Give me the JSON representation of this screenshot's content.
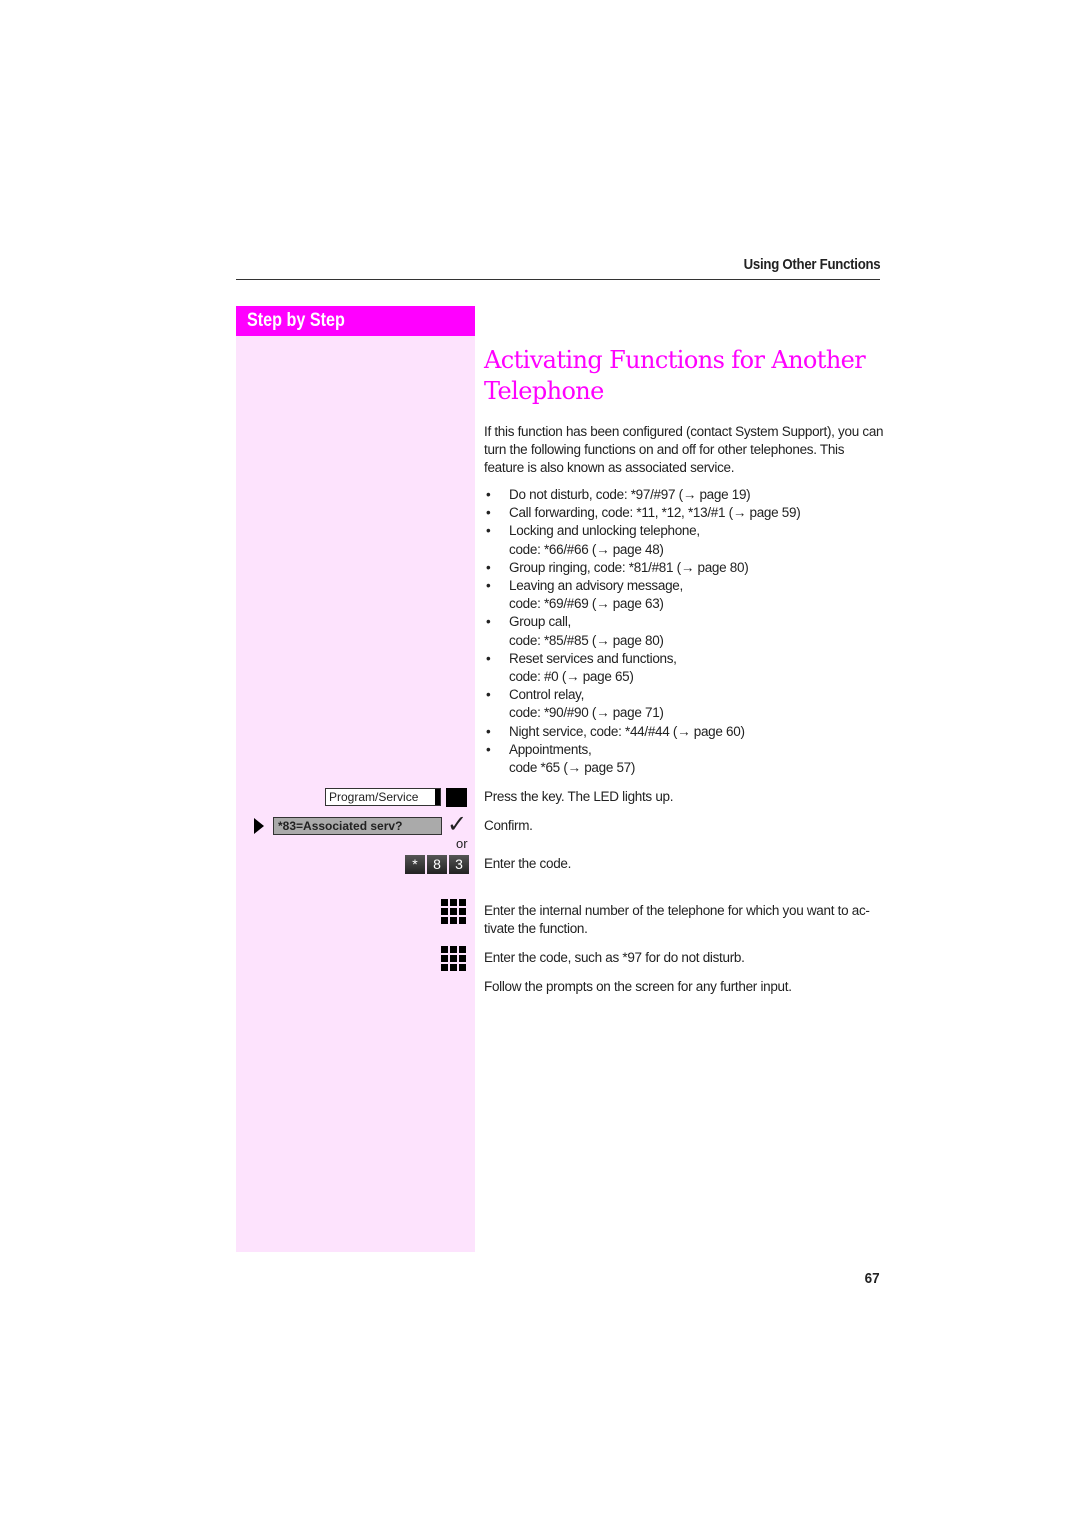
{
  "header": {
    "section_title": "Using Other Functions"
  },
  "sidebar": {
    "heading": "Step by Step",
    "program_key_label": "Program/Service",
    "display_text": "*83=Associated serv?",
    "confirm_symbol": "✓",
    "or_label": "or",
    "code_keys": [
      "*",
      "8",
      "3"
    ]
  },
  "main": {
    "title_line1": "Activating Functions for Another",
    "title_line2": "Telephone",
    "intro": "If this function has been configured (contact System Support), you can turn the following functions on and off for other telephones. This feature is also known as associated service.",
    "bullets": [
      {
        "line1": "Do not disturb, code: *97/#97 (→ page 19)"
      },
      {
        "line1": "Call forwarding, code: *11, *12, *13/#1 (→ page 59)"
      },
      {
        "line1": "Locking and unlocking telephone,",
        "line2": "code: *66/#66 (→ page 48)"
      },
      {
        "line1": "Group ringing, code: *81/#81 (→ page 80)"
      },
      {
        "line1": "Leaving an advisory message,",
        "line2": "code: *69/#69 (→ page 63)"
      },
      {
        "line1": "Group call,",
        "line2": "code: *85/#85 (→ page 80)"
      },
      {
        "line1": "Reset services and functions,",
        "line2": "code: #0 (→ page 65)"
      },
      {
        "line1": "Control relay,",
        "line2": "code: *90/#90 (→ page 71)"
      },
      {
        "line1": "Night service, code: *44/#44 (→ page 60)"
      },
      {
        "line1": "Appointments,",
        "line2": "code *65 (→ page 57)"
      }
    ],
    "steps": {
      "press_key": "Press the key. The LED lights up.",
      "confirm": "Confirm.",
      "enter_code": "Enter the code.",
      "enter_internal": "Enter the internal number of the telephone for which you want to ac-tivate the function.",
      "enter_code_example": "Enter the code, such as *97 for do not disturb.",
      "follow_prompts": "Follow the prompts on the screen for any further input."
    }
  },
  "footer": {
    "page_number": "67"
  },
  "colors": {
    "accent": "#ff00ff",
    "sidebar_bg": "#fde3fd",
    "display_bg": "#aaaaaa"
  }
}
